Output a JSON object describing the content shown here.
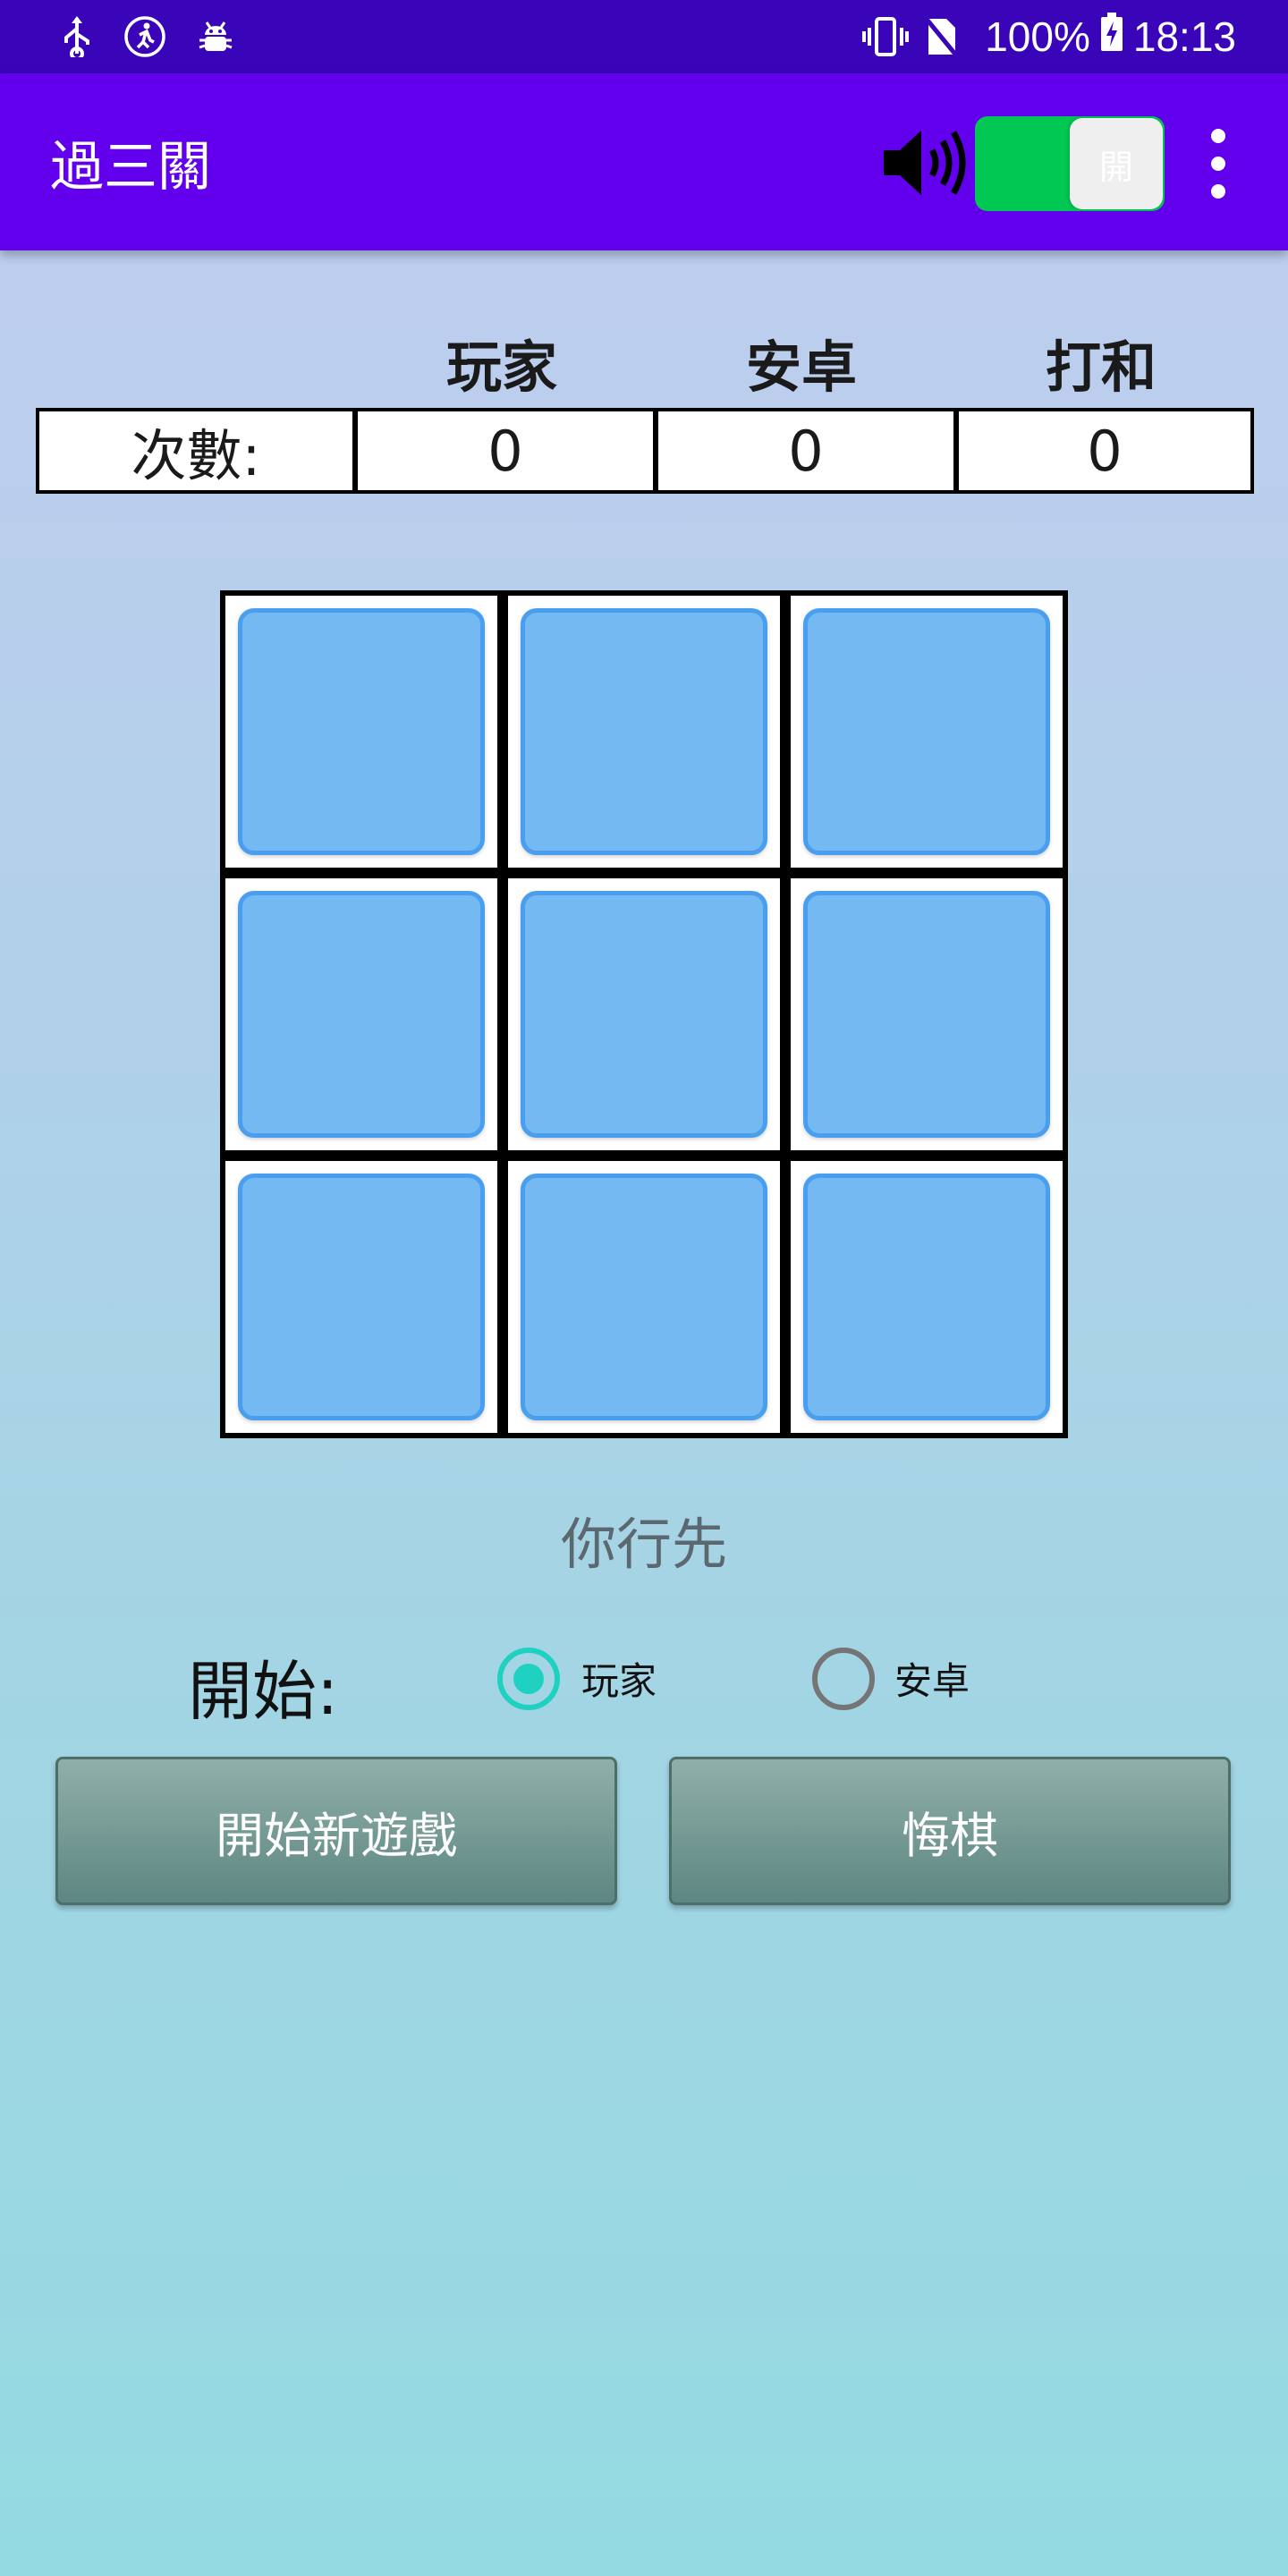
{
  "status_bar": {
    "battery": "100%",
    "time": "18:13",
    "icons_left": [
      "usb-icon",
      "accessibility-icon",
      "android-debug-icon"
    ],
    "icons_right": [
      "vibrate-icon",
      "no-sim-icon",
      "battery-charging-icon"
    ]
  },
  "app_bar": {
    "title": "過三關",
    "switch_label": "開",
    "sound_on": true,
    "colors": {
      "bar": "#6200ee",
      "status": "#3a05b8",
      "switch_track": "#00c853"
    }
  },
  "score": {
    "headers": [
      "玩家",
      "安卓",
      "打和"
    ],
    "row_label": "次數:",
    "values": [
      "0",
      "0",
      "0"
    ]
  },
  "board": {
    "rows": 3,
    "cols": 3,
    "cells": [
      "",
      "",
      "",
      "",
      "",
      "",
      "",
      "",
      ""
    ],
    "tile_color": "#74b9f2"
  },
  "turn_message": "你行先",
  "start": {
    "label": "開始:",
    "options": [
      {
        "label": "玩家",
        "selected": true
      },
      {
        "label": "安卓",
        "selected": false
      }
    ],
    "accent": "#1fd1c1"
  },
  "buttons": {
    "new_game": "開始新遊戲",
    "undo": "悔棋"
  }
}
